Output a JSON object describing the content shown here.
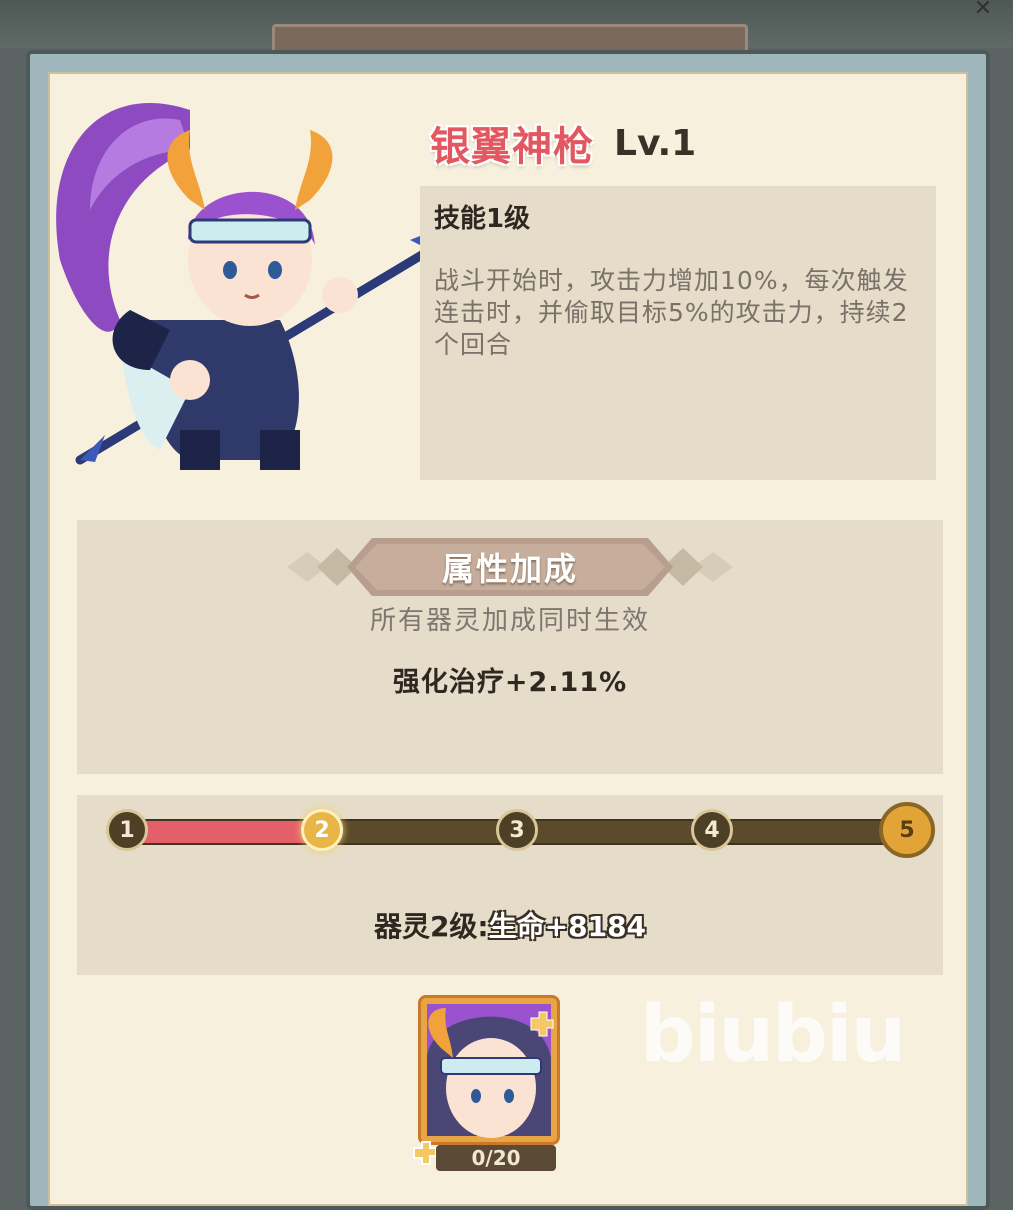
{
  "window": {
    "close_icon": "close-icon"
  },
  "hero": {
    "name": "银翼神枪",
    "level": "Lv.1"
  },
  "skill": {
    "level_label": "技能1级",
    "description": "战斗开始时，攻击力增加10%，每次触发连击时，并偷取目标5%的攻击力，持续2个回合"
  },
  "attributes": {
    "title": "属性加成",
    "subtitle": "所有器灵加成同时生效",
    "value": "强化治疗+2.11%"
  },
  "progress": {
    "nodes": [
      "1",
      "2",
      "3",
      "4",
      "5"
    ],
    "current_node": 2,
    "level_label": "器灵2级:",
    "level_bonus": "生命+8184"
  },
  "shards": {
    "count": "0/20"
  },
  "watermark": "biubiu",
  "colors": {
    "hero_name": "#e25760",
    "track_fill": "#e3606a",
    "track": "#5b4a2c",
    "panel_bg": "#f7f0dd",
    "box_bg": "#e5ddc9"
  }
}
